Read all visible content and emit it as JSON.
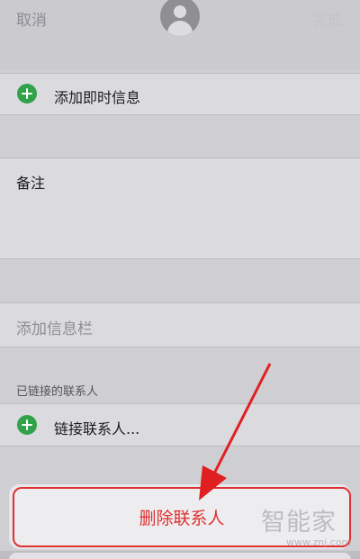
{
  "nav": {
    "cancel": "取消",
    "done": "完成"
  },
  "rows": {
    "add_im": "添加即时信息",
    "notes": "备注",
    "add_field": "添加信息栏",
    "linked_header": "已链接的联系人",
    "link_contact": "链接联系人..."
  },
  "action": {
    "delete_contact": "删除联系人"
  },
  "watermark": {
    "brand": "智能家",
    "url": "www.znj.com"
  },
  "colors": {
    "accent_green": "#30a24a",
    "destructive_red": "#e03030",
    "annotation_red": "#e02020"
  },
  "icons": {
    "avatar": "person-silhouette-icon",
    "add": "green-plus-circle-icon",
    "annotation": "red-arrow"
  }
}
